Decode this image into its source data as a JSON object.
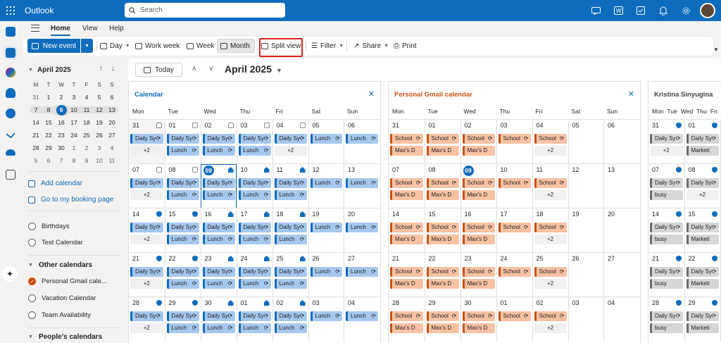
{
  "app": {
    "name": "Outlook"
  },
  "search": {
    "placeholder": "Search"
  },
  "menu": {
    "tabs": [
      "Home",
      "View",
      "Help"
    ]
  },
  "toolbar": {
    "new_event": "New event",
    "day": "Day",
    "work_week": "Work week",
    "week": "Week",
    "month": "Month",
    "split_view": "Split view",
    "filter": "Filter",
    "share": "Share",
    "print": "Print"
  },
  "mini_calendar": {
    "title": "April 2025",
    "weekdays": [
      "M",
      "T",
      "W",
      "T",
      "F",
      "S",
      "S"
    ],
    "weeks": [
      [
        "31",
        "1",
        "2",
        "3",
        "4",
        "5",
        "6"
      ],
      [
        "7",
        "8",
        "9",
        "10",
        "11",
        "12",
        "13"
      ],
      [
        "14",
        "15",
        "16",
        "17",
        "18",
        "19",
        "20"
      ],
      [
        "21",
        "22",
        "23",
        "24",
        "25",
        "26",
        "27"
      ],
      [
        "28",
        "29",
        "30",
        "1",
        "2",
        "3",
        "4"
      ],
      [
        "5",
        "6",
        "7",
        "8",
        "9",
        "10",
        "11"
      ]
    ],
    "today": "9"
  },
  "left_links": {
    "add_calendar": "Add calendar",
    "booking": "Go to my booking page"
  },
  "my_calendars": [
    "Birthdays",
    "Test Calendar"
  ],
  "other_calendars": {
    "title": "Other calendars",
    "items": [
      "Personal Gmail cale...",
      "Vacation Calendar",
      "Team Availability"
    ]
  },
  "people_calendars": {
    "title": "People's calendars"
  },
  "main": {
    "today_button": "Today",
    "month_title": "April 2025"
  },
  "panels": [
    {
      "title": "Calendar",
      "color": "#0f6cbd"
    },
    {
      "title": "Personal Gmail calendar",
      "color": "#ca5010"
    },
    {
      "title": "Kristina Sinyugina",
      "color": "#424242"
    }
  ],
  "day_headers": [
    "Mon",
    "Tue",
    "Wed",
    "Thu",
    "Fri",
    "Sat",
    "Sun"
  ],
  "weeks": [
    [
      "31",
      "01",
      "02",
      "03",
      "04",
      "05",
      "06"
    ],
    [
      "07",
      "08",
      "09",
      "10",
      "11",
      "12",
      "13"
    ],
    [
      "14",
      "15",
      "16",
      "17",
      "18",
      "19",
      "20"
    ],
    [
      "21",
      "22",
      "23",
      "24",
      "25",
      "26",
      "27"
    ],
    [
      "28",
      "29",
      "30",
      "01",
      "02",
      "03",
      "04"
    ]
  ],
  "events": {
    "daily": "Daily Sy",
    "lunch": "Lunch",
    "school": "School",
    "maxs": "Max's D",
    "busy": "busy",
    "marketing": "Marketi",
    "more": "+2"
  },
  "colors": {
    "brand": "#0f6cbd",
    "gmail": "#ca5010",
    "highlight": "#e0201f"
  }
}
